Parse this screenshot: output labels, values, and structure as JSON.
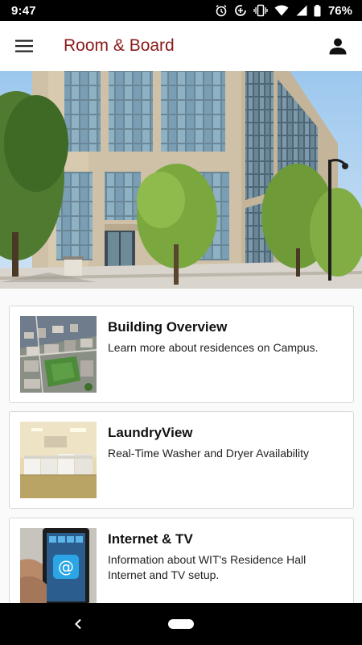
{
  "status_bar": {
    "time": "9:47",
    "battery": "76%",
    "icons": [
      "alarm-icon",
      "data-saver-icon",
      "vibrate-icon",
      "wifi-icon",
      "signal-icon",
      "battery-icon"
    ]
  },
  "app_bar": {
    "title": "Room & Board",
    "menu_icon": "hamburger-menu-icon",
    "profile_icon": "person-icon",
    "title_color": "#8b1a1a"
  },
  "hero": {
    "image": "residence-hall-building-photo"
  },
  "cards": [
    {
      "title": "Building Overview",
      "description": "Learn more about residences on Campus.",
      "image": "aerial-campus-photo"
    },
    {
      "title": "LaundryView",
      "description": "Real-Time Washer and Dryer Availability",
      "image": "laundry-room-photo"
    },
    {
      "title": "Internet & TV",
      "description": "Information about WIT's Residence Hall Internet and TV setup.",
      "image": "phone-internet-photo"
    }
  ],
  "nav_bar": {
    "back_icon": "back-chevron-icon",
    "home_icon": "home-pill-icon"
  }
}
